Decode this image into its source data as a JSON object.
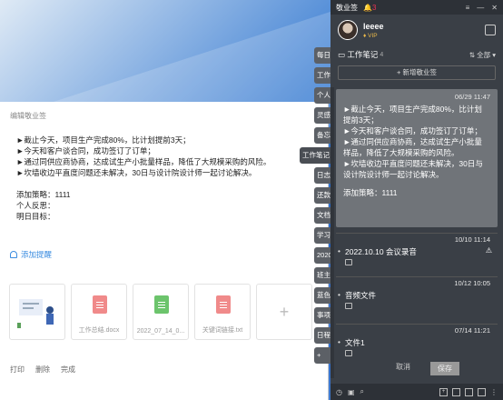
{
  "topbar": {
    "title": "敬业签",
    "badge_count": "3"
  },
  "user": {
    "name": "leeee",
    "vip": "VIP"
  },
  "section": {
    "title": "工作笔记",
    "count": "4",
    "filter": "全部"
  },
  "new_button": "+ 新增敬业签",
  "vertical_tabs": [
    "每日",
    "工作",
    "个人",
    "灵感",
    "备忘",
    "工作笔记",
    "日志",
    "还款",
    "文档",
    "学习",
    "2020",
    "班主",
    "蓝色",
    "事项",
    "日程",
    "+"
  ],
  "active_note": {
    "date": "06/29 11:47",
    "lines": [
      "►截止今天，项目生产完成80%，比计划提前3天；",
      "►今天和客户谈合同，成功签订了订单；",
      "►通过同供应商协商，达成试生产小批量样品，降低了大规模采购的风险。",
      "►坎墙收边平直度问题还未解决，30日与设计院设计师一起讨论解决。",
      "",
      "添加策略：1111"
    ]
  },
  "notes": [
    {
      "date": "10/10 11:14",
      "title": "2022.10.10 会议录音"
    },
    {
      "date": "10/12 10:05",
      "title": "音频文件"
    },
    {
      "date": "07/14 11:21",
      "title": "文件1"
    }
  ],
  "panel_actions": {
    "cancel": "取消",
    "save": "保存"
  },
  "editor": {
    "title": "编辑敬业签",
    "lines": [
      "►截止今天，项目生产完成80%，比计划提前3天；",
      "►今天和客户谈合同，成功签订了订单；",
      "►通过同供应商协商，达成试生产小批量样品，降低了大规模采购的风险。",
      "►坎墙收边平直度问题还未解决，30日与设计院设计师一起讨论解决。",
      "",
      "添加策略：1111",
      "个人反思：",
      "明日目标："
    ],
    "add_reminder": "添加提醒",
    "attachments": [
      {
        "name": ""
      },
      {
        "name": "工作总结.docx",
        "color": "#f08a8a"
      },
      {
        "name": "2022_07_14_0...",
        "color": "#6cc46c"
      },
      {
        "name": "关键词链接.txt",
        "color": "#f08a8a"
      }
    ],
    "actions": [
      "打印",
      "删除",
      "完成"
    ]
  }
}
